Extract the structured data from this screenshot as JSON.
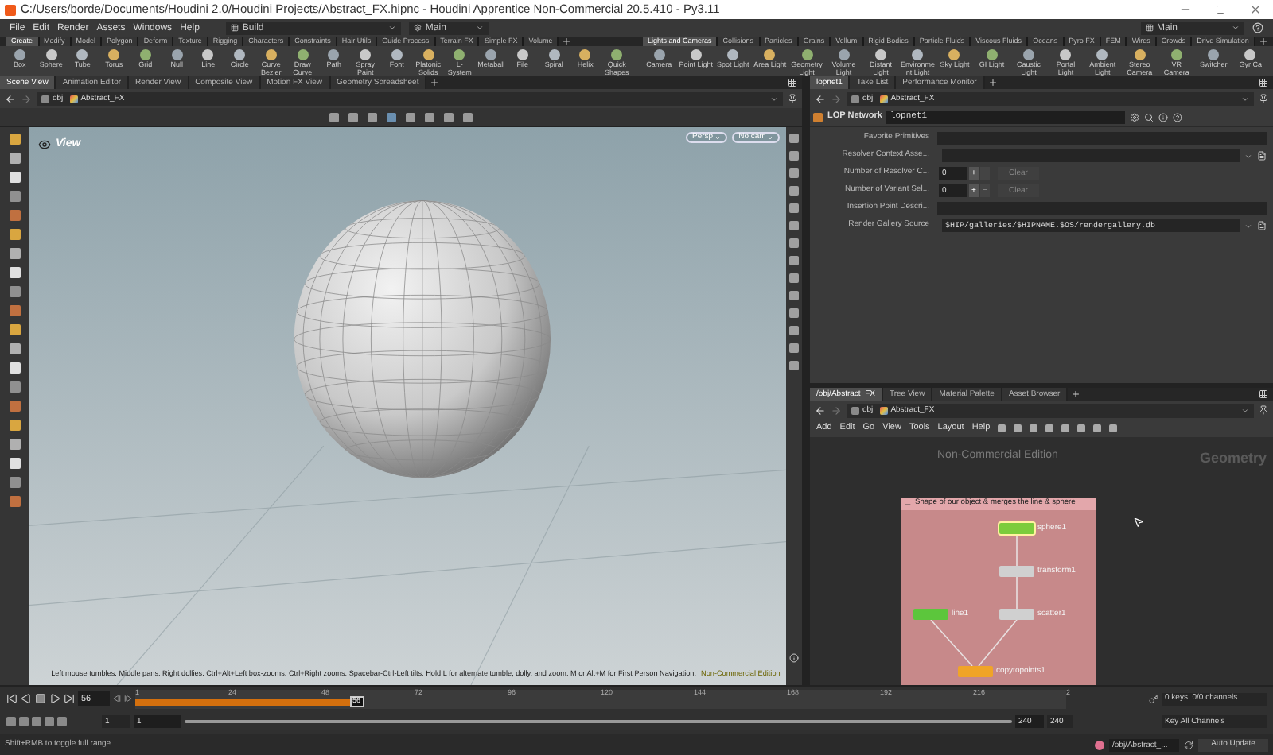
{
  "window": {
    "title": "C:/Users/borde/Documents/Houdini 2.0/Houdini Projects/Abstract_FX.hipnc - Houdini Apprentice Non-Commercial 20.5.410 - Py3.11"
  },
  "menu": [
    "File",
    "Edit",
    "Render",
    "Assets",
    "Windows",
    "Help"
  ],
  "desktop": {
    "label": "Build"
  },
  "layout": {
    "label": "Main"
  },
  "right_layout": {
    "label": "Main"
  },
  "shelf_left": {
    "tabs": [
      {
        "label": "Create",
        "selected": true
      },
      {
        "label": "Modify",
        "selected": false
      },
      {
        "label": "Model",
        "selected": false
      },
      {
        "label": "Polygon",
        "selected": false
      },
      {
        "label": "Deform",
        "selected": false
      },
      {
        "label": "Texture",
        "selected": false
      },
      {
        "label": "Rigging",
        "selected": false
      },
      {
        "label": "Characters",
        "selected": false
      },
      {
        "label": "Constraints",
        "selected": false
      },
      {
        "label": "Hair Utils",
        "selected": false
      },
      {
        "label": "Guide Process",
        "selected": false
      },
      {
        "label": "Terrain FX",
        "selected": false
      },
      {
        "label": "Simple FX",
        "selected": false
      },
      {
        "label": "Volume",
        "selected": false
      }
    ],
    "tools": [
      "Box",
      "Sphere",
      "Tube",
      "Torus",
      "Grid",
      "Null",
      "Line",
      "Circle",
      "Curve Bezier",
      "Draw Curve",
      "Path",
      "Spray Paint",
      "Font",
      "Platonic Solids",
      "L-System",
      "Metaball",
      "File",
      "Spiral",
      "Helix",
      "Quick Shapes"
    ]
  },
  "shelf_right": {
    "tabs": [
      {
        "label": "Lights and Cameras",
        "selected": true
      },
      {
        "label": "Collisions",
        "selected": false
      },
      {
        "label": "Particles",
        "selected": false
      },
      {
        "label": "Grains",
        "selected": false
      },
      {
        "label": "Vellum",
        "selected": false
      },
      {
        "label": "Rigid Bodies",
        "selected": false
      },
      {
        "label": "Particle Fluids",
        "selected": false
      },
      {
        "label": "Viscous Fluids",
        "selected": false
      },
      {
        "label": "Oceans",
        "selected": false
      },
      {
        "label": "Pyro FX",
        "selected": false
      },
      {
        "label": "FEM",
        "selected": false
      },
      {
        "label": "Wires",
        "selected": false
      },
      {
        "label": "Crowds",
        "selected": false
      },
      {
        "label": "Drive Simulation",
        "selected": false
      }
    ],
    "tools": [
      "Camera",
      "Point Light",
      "Spot Light",
      "Area Light",
      "Geometry Light",
      "Volume Light",
      "Distant Light",
      "Environment Light",
      "Sky Light",
      "GI Light",
      "Caustic Light",
      "Portal Light",
      "Ambient Light",
      "Stereo Camera",
      "VR Camera",
      "Switcher",
      "Gyr Ca"
    ]
  },
  "scene_pane": {
    "tabs": [
      {
        "label": "Scene View",
        "selected": true
      },
      {
        "label": "Animation Editor",
        "selected": false
      },
      {
        "label": "Render View",
        "selected": false
      },
      {
        "label": "Composite View",
        "selected": false
      },
      {
        "label": "Motion FX View",
        "selected": false
      },
      {
        "label": "Geometry Spreadsheet",
        "selected": false
      }
    ],
    "path": [
      "obj",
      "Abstract_FX"
    ],
    "viewport": {
      "title": "View",
      "projection": "Persp",
      "camera": "No cam",
      "hint": "Left mouse tumbles. Middle pans. Right dollies. Ctrl+Alt+Left box-zooms. Ctrl+Right zooms. Spacebar-Ctrl-Left tilts. Hold L for alternate tumble, dolly, and zoom. M or Alt+M for First Person Navigation.",
      "edition": "Non-Commercial Edition"
    }
  },
  "param_pane": {
    "tabs": [
      {
        "label": "lopnet1",
        "selected": true
      },
      {
        "label": "Take List",
        "selected": false
      },
      {
        "label": "Performance Monitor",
        "selected": false
      }
    ],
    "path": [
      "obj",
      "Abstract_FX"
    ],
    "node_type": "LOP Network",
    "node_name": "lopnet1",
    "params": [
      {
        "kind": "text",
        "label": "Favorite Primitives"
      },
      {
        "kind": "menu",
        "label": "Resolver Context Asse..."
      },
      {
        "kind": "count",
        "label": "Number of Resolver C...",
        "value": "0",
        "plus": "+",
        "minus": "−",
        "button": "Clear"
      },
      {
        "kind": "count",
        "label": "Number of Variant Sel...",
        "value": "0",
        "plus": "+",
        "minus": "−",
        "button": "Clear"
      },
      {
        "kind": "text",
        "label": "Insertion Point Descri..."
      },
      {
        "kind": "menu",
        "label": "Render Gallery Source",
        "value": "$HIP/galleries/$HIPNAME.$OS/rendergallery.db"
      }
    ]
  },
  "network_pane": {
    "tabs": [
      {
        "label": "/obj/Abstract_FX",
        "selected": true
      },
      {
        "label": "Tree View",
        "selected": false
      },
      {
        "label": "Material Palette",
        "selected": false
      },
      {
        "label": "Asset Browser",
        "selected": false
      }
    ],
    "path": [
      "obj",
      "Abstract_FX"
    ],
    "menu": [
      "Add",
      "Edit",
      "Go",
      "View",
      "Tools",
      "Layout",
      "Help"
    ],
    "edition": "Non-Commercial Edition",
    "context": "Geometry",
    "netbox": {
      "title": "Shape of our object & merges the line & sphere",
      "nodes": [
        {
          "name": "sphere1",
          "color": "#7ccc3c",
          "selected": true
        },
        {
          "name": "transform1",
          "color": "#d0d0d0",
          "selected": false
        },
        {
          "name": "line1",
          "color": "#5cc63c",
          "selected": false
        },
        {
          "name": "scatter1",
          "color": "#d0d0d0",
          "selected": false
        },
        {
          "name": "copytopoints1",
          "color": "#f0a428",
          "selected": false
        }
      ]
    }
  },
  "timeline": {
    "frame": "56",
    "level": 0.23,
    "marker": "56",
    "ticks": [
      "1",
      "24",
      "48",
      "72",
      "96",
      "120",
      "144",
      "168",
      "192",
      "216",
      "2"
    ],
    "start": "1",
    "range_start": "1",
    "range_end": "240",
    "range": {
      "level": 1
    },
    "end": "240",
    "keys": "0 keys, 0/0 channels",
    "key_button": "Key All Channels"
  },
  "status": {
    "hint": "Shift+RMB to toggle full range",
    "path": "/obj/Abstract_...",
    "update": "Auto Update"
  }
}
